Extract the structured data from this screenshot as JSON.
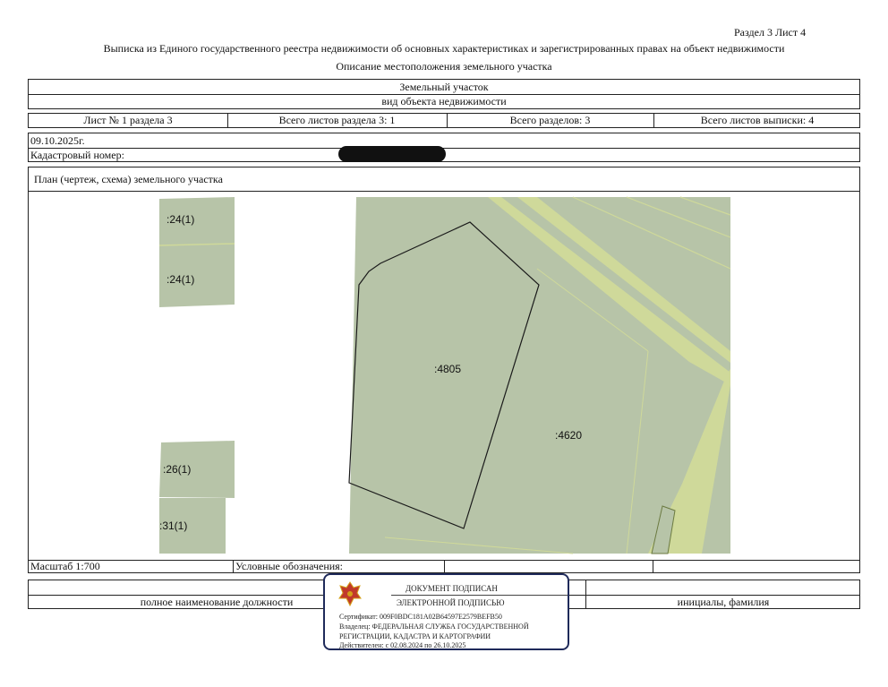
{
  "header": {
    "section_sheet": "Раздел 3   Лист 4",
    "title": "Выписка из Единого государственного реестра недвижимости об основных характеристиках и зарегистрированных правах на объект недвижимости",
    "subtitle": "Описание местоположения земельного участка"
  },
  "object": {
    "name": "Земельный участок",
    "type_caption": "вид объекта недвижимости"
  },
  "sheets": {
    "sheet": "Лист № 1 раздела 3",
    "total_sheets_section": "Всего листов раздела 3: 1",
    "total_sections": "Всего разделов: 3",
    "total_extract_sheets": "Всего листов выписки: 4"
  },
  "date": "09.10.2025г.",
  "cadastral_label": "Кадастровый номер:",
  "plan_title": "План (чертеж, схема) земельного участка",
  "parcels": [
    ":24(1)",
    ":24(1)",
    ":4805",
    ":4620",
    ":26(1)",
    ":31(1)"
  ],
  "scale": "Масштаб 1:700",
  "legend_label": "Условные обозначения:",
  "footer": {
    "position_caption": "полное наименование должности",
    "name_caption": "инициалы, фамилия"
  },
  "stamp": {
    "line1": "ДОКУМЕНТ ПОДПИСАН",
    "line2": "ЭЛЕКТРОННОЙ ПОДПИСЬЮ",
    "certificate": "Сертификат: 009F0BDC181A02B64597E2579BEFB50",
    "owner_line1": "Владелец: ФЕДЕРАЛЬНАЯ СЛУЖБА ГОСУДАРСТВЕННОЙ",
    "owner_line2": "РЕГИСТРАЦИИ, КАДАСТРА И КАРТОГРАФИИ",
    "validity": "Действителен: с 02.08.2024 по 26.10.2025"
  },
  "colors": {
    "parcel_fill": "#b7c4a8",
    "road_fill": "#cfd99a",
    "stamp_border": "#1f2a5a",
    "emblem": "#c0392b"
  }
}
